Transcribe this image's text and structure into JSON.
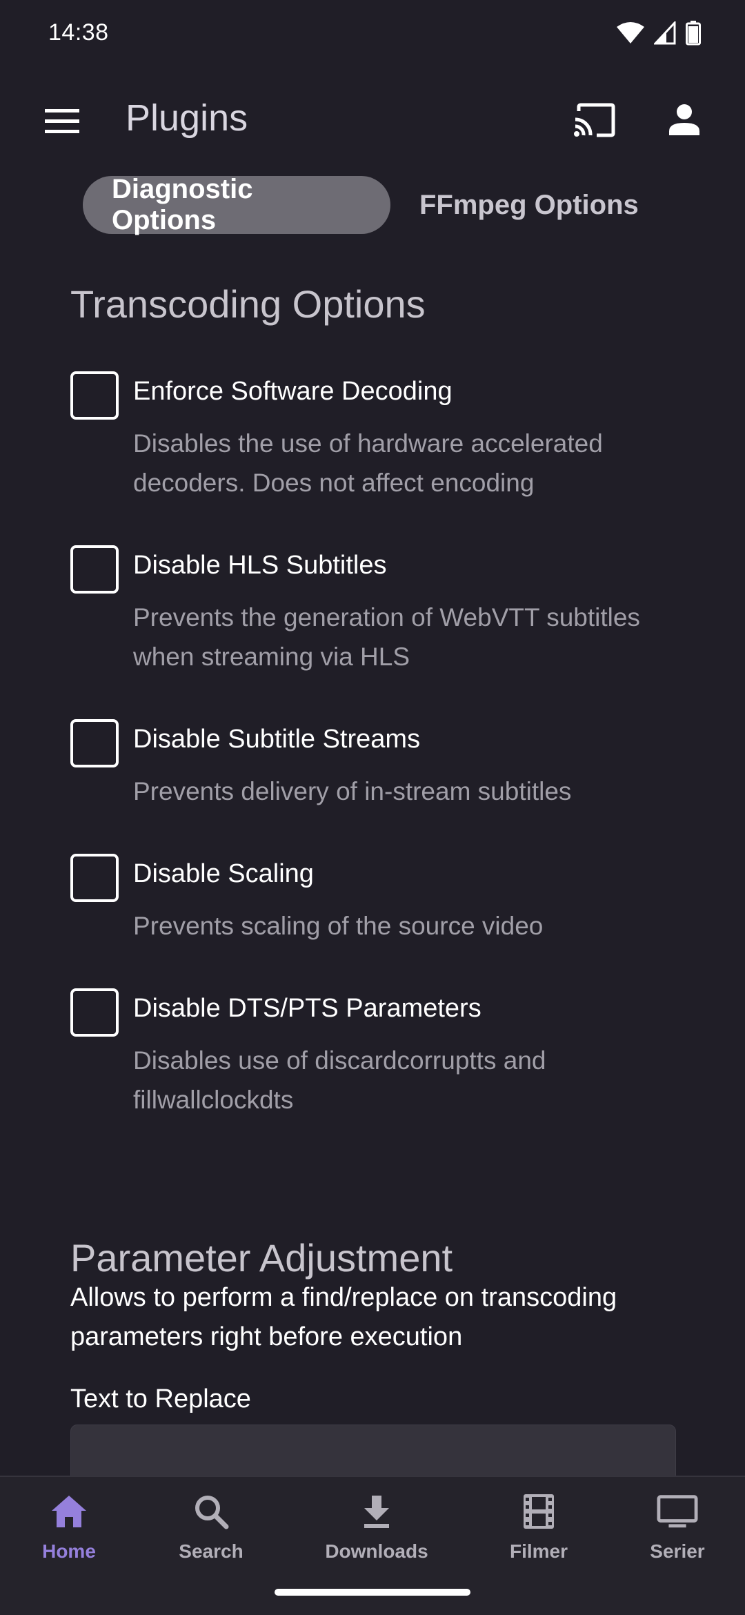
{
  "status_bar": {
    "time": "14:38"
  },
  "app_bar": {
    "title": "Plugins"
  },
  "tabs": [
    {
      "label": "Diagnostic Options",
      "active": true
    },
    {
      "label": "FFmpeg Options",
      "active": false
    }
  ],
  "transcoding": {
    "title": "Transcoding Options",
    "options": [
      {
        "label": "Enforce Software Decoding",
        "description": "Disables the use of hardware accelerated decoders. Does not affect encoding",
        "checked": false
      },
      {
        "label": "Disable HLS Subtitles",
        "description": "Prevents the generation of WebVTT subtitles when streaming via HLS",
        "checked": false
      },
      {
        "label": "Disable Subtitle Streams",
        "description": "Prevents delivery of in-stream subtitles",
        "checked": false
      },
      {
        "label": "Disable Scaling",
        "description": "Prevents scaling of the source video",
        "checked": false
      },
      {
        "label": "Disable DTS/PTS Parameters",
        "description": "Disables use of discardcorruptts and fillwallclockdts",
        "checked": false
      }
    ]
  },
  "parameter_adjustment": {
    "title": "Parameter Adjustment",
    "description": "Allows to perform a find/replace on transcoding parameters right before execution",
    "field_label": "Text to Replace",
    "field_value": ""
  },
  "bottom_nav": [
    {
      "label": "Home",
      "icon": "home-icon",
      "active": true
    },
    {
      "label": "Search",
      "icon": "search-icon",
      "active": false
    },
    {
      "label": "Downloads",
      "icon": "download-icon",
      "active": false
    },
    {
      "label": "Filmer",
      "icon": "film-icon",
      "active": false
    },
    {
      "label": "Serier",
      "icon": "tv-icon",
      "active": false
    }
  ],
  "colors": {
    "accent": "#9580dc",
    "background": "#201e27",
    "nav_background": "#25232b"
  }
}
